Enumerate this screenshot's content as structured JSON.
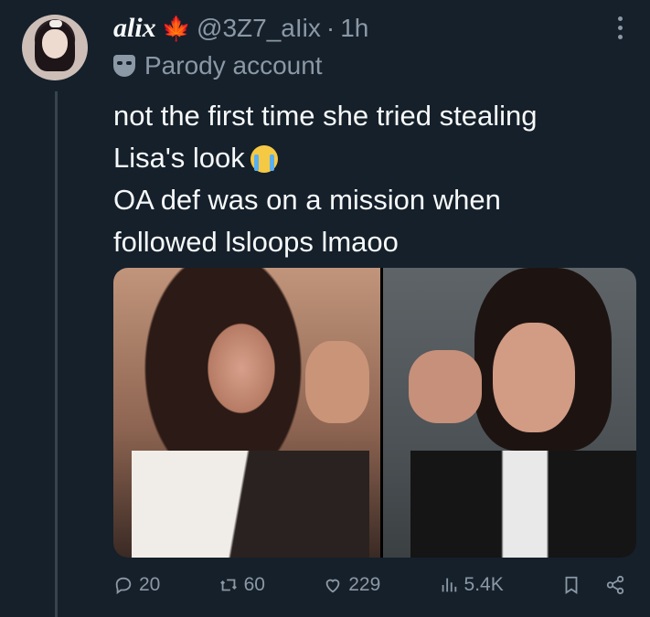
{
  "user": {
    "display_name": "alix",
    "handle": "@3Z7_aIix",
    "dot": "·",
    "time": "1h",
    "parody_label": "Parody account"
  },
  "tweet": {
    "lines": [
      "not the first time she tried stealing",
      "Lisa's look",
      "OA def was on a mission when",
      "followed lsloops lmaoo"
    ]
  },
  "actions": {
    "replies": "20",
    "retweets": "60",
    "likes": "229",
    "views": "5.4K"
  },
  "icons": {
    "flag": "maple-leaf-icon",
    "parody": "mask-icon",
    "emoji": "loudly-crying-face-emoji",
    "more": "more-icon",
    "reply": "reply-icon",
    "retweet": "retweet-icon",
    "like": "heart-icon",
    "views": "views-icon",
    "bookmark": "bookmark-icon",
    "share": "share-icon"
  },
  "colors": {
    "background": "#15202b",
    "text": "#f7f9f9",
    "muted": "#8b98a5",
    "flag": "#e0301e"
  }
}
